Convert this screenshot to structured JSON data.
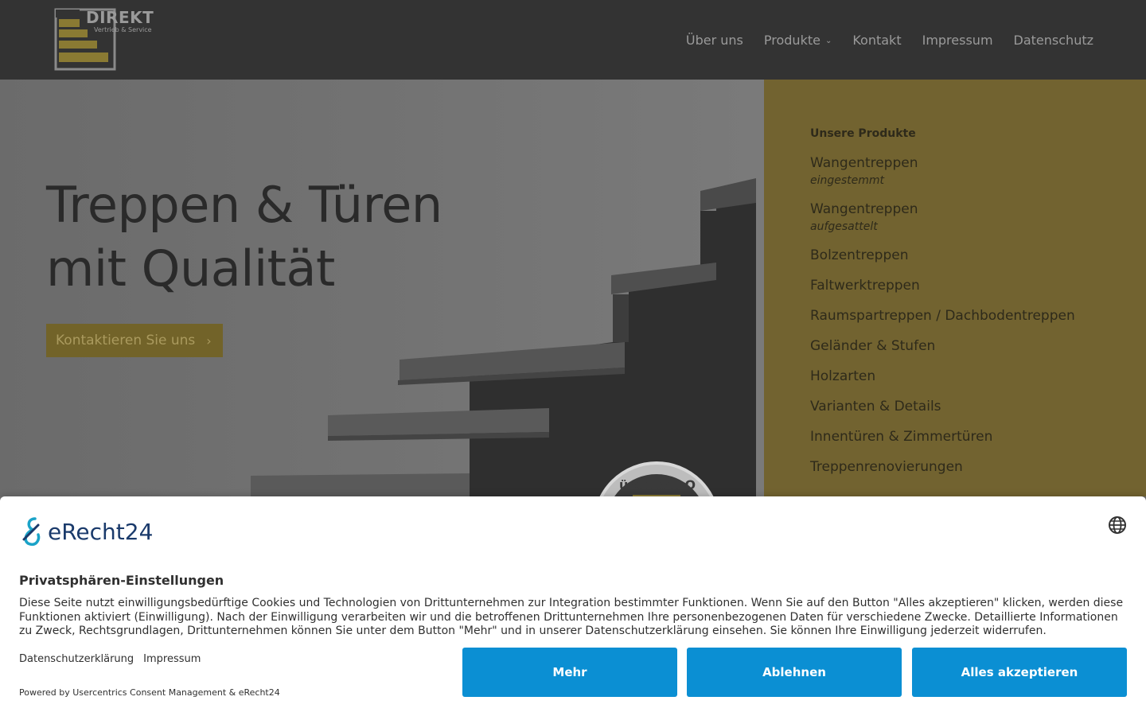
{
  "header": {
    "logo": {
      "title": "DIREKT",
      "subtitle": "Vertrieb & Service"
    },
    "nav": [
      {
        "label": "Über uns"
      },
      {
        "label": "Produkte",
        "has_dropdown": true
      },
      {
        "label": "Kontakt"
      },
      {
        "label": "Impressum"
      },
      {
        "label": "Datenschutz"
      }
    ]
  },
  "hero": {
    "title_line1": "Treppen & Türen",
    "title_line2": "mit Qualität",
    "cta_label": "Kontaktieren Sie uns",
    "badge_text": "üren mit Q"
  },
  "sidebar": {
    "heading": "Unsere Produkte",
    "items": [
      {
        "label": "Wangentreppen",
        "sub": "eingestemmt"
      },
      {
        "label": "Wangentreppen",
        "sub": "aufgesattelt"
      },
      {
        "label": "Bolzentreppen"
      },
      {
        "label": "Faltwerktreppen"
      },
      {
        "label": "Raumspartreppen / Dachbodentreppen"
      },
      {
        "label": "Geländer & Stufen"
      },
      {
        "label": "Holzarten"
      },
      {
        "label": "Varianten & Details"
      },
      {
        "label": "Innentüren & Zimmertüren"
      },
      {
        "label": "Treppenrenovierungen"
      }
    ]
  },
  "consent": {
    "logo_text": "eRecht24",
    "title": "Privatsphären-Einstellungen",
    "text": "Diese Seite nutzt einwilligungsbedürftige Cookies und Technologien von Drittunternehmen zur Integration bestimmter Funktionen. Wenn Sie auf den Button \"Alles akzeptieren\" klicken, werden diese Funktionen aktiviert (Einwilligung). Nach der Einwilligung verarbeiten wir und die betroffenen Drittunternehmen Ihre personenbezogenen Daten für verschiedene Zwecke. Detaillierte Informationen zu Zweck, Rechtsgrundlagen, Drittunternehmen können Sie unter dem Button \"Mehr\" und in unserer Datenschutzerklärung einsehen. Sie können Ihre Einwilligung jederzeit widerrufen.",
    "links": {
      "privacy": "Datenschutzerklärung",
      "imprint": "Impressum"
    },
    "powered_by": "Powered by Usercentrics Consent Management & eRecht24",
    "buttons": {
      "more": "Mehr",
      "decline": "Ablehnen",
      "accept_all": "Alles akzeptieren"
    }
  },
  "colors": {
    "header_bg": "#333333",
    "accent_gold": "#726330",
    "consent_button": "#0b8fd3"
  }
}
